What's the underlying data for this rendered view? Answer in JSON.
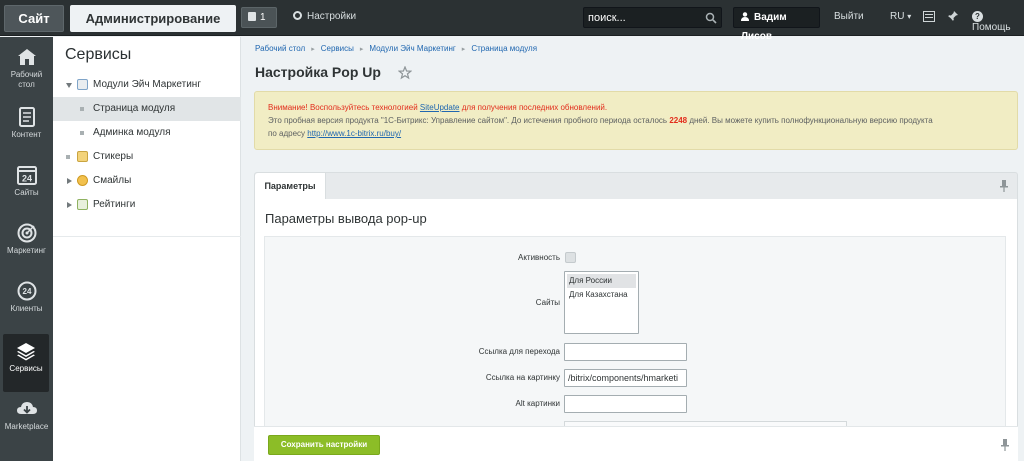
{
  "topbar": {
    "site_tab": "Сайт",
    "admin_tab": "Администрирование",
    "notifications_count": "1",
    "settings_label": "Настройки",
    "search_placeholder": "поиск...",
    "user_name": "Вадим Лисов",
    "logout_label": "Выйти",
    "language": "RU",
    "help_label": "Помощь"
  },
  "left_menu": {
    "items": [
      {
        "label_1": "Рабочий",
        "label_2": "стол",
        "icon": "home-icon"
      },
      {
        "label_1": "Контент",
        "label_2": "",
        "icon": "content-icon"
      },
      {
        "label_1": "Сайты",
        "label_2": "",
        "icon": "calendar-24-icon",
        "badge": "24"
      },
      {
        "label_1": "Маркетинг",
        "label_2": "",
        "icon": "target-icon"
      },
      {
        "label_1": "Клиенты",
        "label_2": "",
        "icon": "clients-24-icon",
        "badge": "24"
      },
      {
        "label_1": "Сервисы",
        "label_2": "",
        "icon": "layers-icon",
        "active": true
      },
      {
        "label_1": "Marketplace",
        "label_2": "",
        "icon": "cloud-download-icon"
      }
    ]
  },
  "sidebar": {
    "title": "Сервисы",
    "tree": [
      {
        "label": "Модули Эйч Маркетинг",
        "level": 0,
        "arrow": "down",
        "icon": "module-icon"
      },
      {
        "label": "Страница модуля",
        "level": 1,
        "selected": true
      },
      {
        "label": "Админка модуля",
        "level": 1
      },
      {
        "label": "Стикеры",
        "level": 0,
        "arrow": "none",
        "icon": "sticker-icon"
      },
      {
        "label": "Смайлы",
        "level": 0,
        "arrow": "right",
        "icon": "smile-icon"
      },
      {
        "label": "Рейтинги",
        "level": 0,
        "arrow": "right",
        "icon": "rating-icon"
      }
    ]
  },
  "breadcrumbs": [
    "Рабочий стол",
    "Сервисы",
    "Модули Эйч Маркетинг",
    "Страница модуля"
  ],
  "page_title": "Настройка Pop Up",
  "warning": {
    "line1_prefix": "Внимание! Воспользуйтесь технологией ",
    "line1_link": "SiteUpdate",
    "line1_suffix": " для получения последних обновлений.",
    "line2_prefix": "Это пробная версия продукта \"1С-Битрикс: Управление сайтом\". До истечения пробного периода осталось ",
    "days": "2248",
    "line2_suffix": " дней. Вы можете купить полнофункциональную версию продукта",
    "line3_prefix": "по адресу ",
    "line3_link": "http://www.1c-bitrix.ru/buy/"
  },
  "tabs": {
    "params_label": "Параметры"
  },
  "form": {
    "section_title": "Параметры вывода pop-up",
    "active_label": "Активность",
    "active_checked": false,
    "sites_label": "Сайты",
    "sites_options": [
      "Для России",
      "Для Казахстана"
    ],
    "sites_selected": "Для России",
    "link_label": "Ссылка для перехода",
    "link_value": "",
    "image_link_label": "Ссылка на картинку",
    "image_link_value": "/bitrix/components/hmarketi",
    "alt_label": "Alt картинки",
    "alt_value": ""
  },
  "footer": {
    "save_label": "Сохранить настройки"
  }
}
